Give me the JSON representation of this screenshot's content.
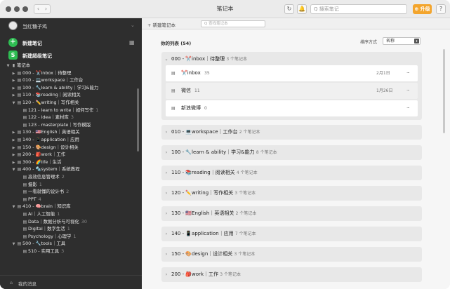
{
  "window": {
    "title": "笔记本",
    "nav_back": "‹",
    "nav_fwd": "›",
    "refresh_icon": "↻",
    "bell_icon": "🔔",
    "search_placeholder": "Q 搜索笔记",
    "upgrade_label": "⊕ 升级",
    "help_icon": "?"
  },
  "sidebar": {
    "username": "当红糖子鸡",
    "new_note": "新建笔记",
    "new_super_note": "新建超级笔记",
    "super_badge": "S",
    "tree": [
      {
        "indent": 0,
        "tw": "▼",
        "icon": "▮",
        "label": "笔记本",
        "count": ""
      },
      {
        "indent": 1,
        "tw": "▶",
        "icon": "▤",
        "label": "000 - ✂️inbox｜待整理",
        "count": ""
      },
      {
        "indent": 1,
        "tw": "▶",
        "icon": "▤",
        "label": "010 - 💻workspace｜工作台",
        "count": ""
      },
      {
        "indent": 1,
        "tw": "▶",
        "icon": "▤",
        "label": "100 - 🔧learn & ability｜学习&能力",
        "count": ""
      },
      {
        "indent": 1,
        "tw": "▶",
        "icon": "▤",
        "label": "110 - 📚reading｜阅读相关",
        "count": ""
      },
      {
        "indent": 1,
        "tw": "▼",
        "icon": "▤",
        "label": "120 - ✏️writing｜写作相关",
        "count": ""
      },
      {
        "indent": 2,
        "tw": "",
        "icon": "▤",
        "label": "121 - learn to write｜如何写作",
        "count": "1"
      },
      {
        "indent": 2,
        "tw": "",
        "icon": "▤",
        "label": "122 - idea｜素材库",
        "count": "3"
      },
      {
        "indent": 2,
        "tw": "",
        "icon": "▤",
        "label": "123 - masterplate｜写作模版",
        "count": ""
      },
      {
        "indent": 1,
        "tw": "▶",
        "icon": "▤",
        "label": "130 - 🇺🇸English｜英语相关",
        "count": ""
      },
      {
        "indent": 1,
        "tw": "▶",
        "icon": "▤",
        "label": "140 - 📱application｜应用",
        "count": ""
      },
      {
        "indent": 1,
        "tw": "▶",
        "icon": "▤",
        "label": "150 - 🎨design｜设计相关",
        "count": ""
      },
      {
        "indent": 1,
        "tw": "▶",
        "icon": "▤",
        "label": "200 - 🎒work｜工作",
        "count": ""
      },
      {
        "indent": 1,
        "tw": "▶",
        "icon": "▤",
        "label": "300 - 🌈life｜生活",
        "count": ""
      },
      {
        "indent": 1,
        "tw": "▼",
        "icon": "▤",
        "label": "400 - 🔩system｜系统教程",
        "count": ""
      },
      {
        "indent": 2,
        "tw": "",
        "icon": "▤",
        "label": "高效信息管理术",
        "count": "2"
      },
      {
        "indent": 2,
        "tw": "",
        "icon": "▤",
        "label": "摄影",
        "count": "1"
      },
      {
        "indent": 2,
        "tw": "",
        "icon": "▤",
        "label": "一看就懂的设计书",
        "count": "2"
      },
      {
        "indent": 2,
        "tw": "",
        "icon": "▤",
        "label": "PPT",
        "count": "4"
      },
      {
        "indent": 1,
        "tw": "▼",
        "icon": "▤",
        "label": "410 - 🧠brain｜知识库",
        "count": ""
      },
      {
        "indent": 2,
        "tw": "",
        "icon": "▤",
        "label": "AI｜人工智能",
        "count": "1"
      },
      {
        "indent": 2,
        "tw": "",
        "icon": "▤",
        "label": "Data｜数据分析与可视化",
        "count": "30"
      },
      {
        "indent": 2,
        "tw": "",
        "icon": "▤",
        "label": "Digital｜数字生活",
        "count": "1"
      },
      {
        "indent": 2,
        "tw": "",
        "icon": "▤",
        "label": "Psychology｜心理学",
        "count": "1"
      },
      {
        "indent": 1,
        "tw": "▼",
        "icon": "▤",
        "label": "500 - 🔧tools｜工具",
        "count": ""
      },
      {
        "indent": 2,
        "tw": "",
        "icon": "▤",
        "label": "510 - 实用工具",
        "count": "3"
      }
    ],
    "footer_label": "我的消息"
  },
  "main": {
    "new_notebook": "+ 新建笔记本",
    "filter_placeholder": "Q 查找笔记本",
    "list_title": "你的列表 (54)",
    "sort_label": "排序方式",
    "sort_value": "名称",
    "open_group": {
      "chevron": "⌄",
      "title": "000 - ✂️inbox｜待整理",
      "count": "3 个笔记本"
    },
    "open_items": [
      {
        "icon": "▤",
        "name": "✂️inbox",
        "count": "35",
        "date": "2月1日",
        "more": "···"
      },
      {
        "icon": "▤",
        "name": "微信",
        "count": "11",
        "date": "1月26日",
        "more": "···"
      },
      {
        "icon": "▤",
        "name": "新浪微博",
        "count": "0",
        "date": "",
        "more": "···"
      }
    ],
    "groups": [
      {
        "chevron": "›",
        "title": "010 - 💻workspace｜工作台",
        "count": "2 个笔记本"
      },
      {
        "chevron": "›",
        "title": "100 - 🔧learn & ability｜学习&能力",
        "count": "8 个笔记本"
      },
      {
        "chevron": "›",
        "title": "110 - 📚reading｜阅读相关",
        "count": "4 个笔记本"
      },
      {
        "chevron": "›",
        "title": "120 - ✏️writing｜写作相关",
        "count": "3 个笔记本"
      },
      {
        "chevron": "›",
        "title": "130 - 🇺🇸English｜英语相关",
        "count": "2 个笔记本"
      },
      {
        "chevron": "›",
        "title": "140 - 📱application｜应用",
        "count": "7 个笔记本"
      },
      {
        "chevron": "›",
        "title": "150 - 🎨design｜设计相关",
        "count": "3 个笔记本"
      },
      {
        "chevron": "›",
        "title": "200 - 🎒work｜工作",
        "count": "3 个笔记本"
      }
    ]
  },
  "colors": {
    "sidebar_bg": "#2e2e2e",
    "accent_green": "#2ebd52",
    "upgrade_orange": "#f3a52d"
  }
}
